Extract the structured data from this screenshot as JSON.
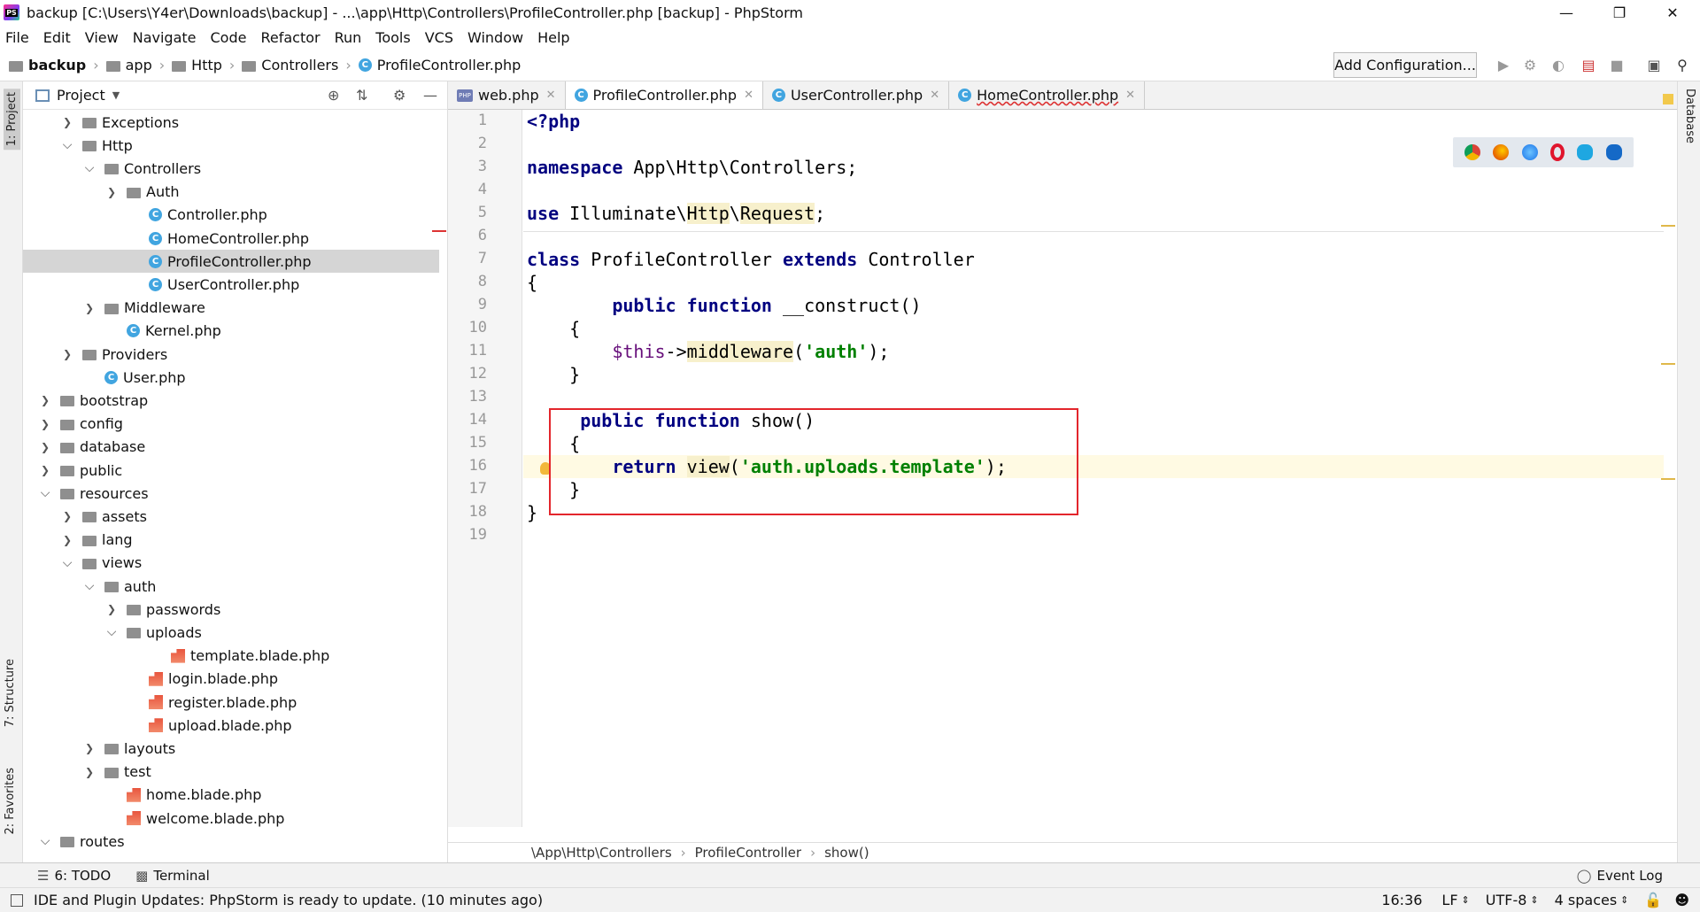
{
  "window": {
    "title": "backup [C:\\Users\\Y4er\\Downloads\\backup] - ...\\app\\Http\\Controllers\\ProfileController.php [backup] - PhpStorm"
  },
  "menu": [
    "File",
    "Edit",
    "View",
    "Navigate",
    "Code",
    "Refactor",
    "Run",
    "Tools",
    "VCS",
    "Window",
    "Help"
  ],
  "breadcrumb": [
    "backup",
    "app",
    "Http",
    "Controllers",
    "ProfileController.php"
  ],
  "toolbar": {
    "add_configuration": "Add Configuration..."
  },
  "side_tabs": {
    "project": "1: Project",
    "structure": "7: Structure",
    "favorites": "2: Favorites",
    "database": "Database"
  },
  "project_panel": {
    "title": "Project",
    "tree": [
      {
        "label": "Exceptions",
        "type": "folder",
        "level": 2,
        "arrow": "right"
      },
      {
        "label": "Http",
        "type": "folder",
        "level": 2,
        "arrow": "down"
      },
      {
        "label": "Controllers",
        "type": "folder",
        "level": 3,
        "arrow": "down"
      },
      {
        "label": "Auth",
        "type": "folder",
        "level": 4,
        "arrow": "right"
      },
      {
        "label": "Controller.php",
        "type": "class",
        "level": 5,
        "arrow": ""
      },
      {
        "label": "HomeController.php",
        "type": "class",
        "level": 5,
        "arrow": ""
      },
      {
        "label": "ProfileController.php",
        "type": "class",
        "level": 5,
        "arrow": "",
        "selected": true
      },
      {
        "label": "UserController.php",
        "type": "class",
        "level": 5,
        "arrow": ""
      },
      {
        "label": "Middleware",
        "type": "folder",
        "level": 3,
        "arrow": "right"
      },
      {
        "label": "Kernel.php",
        "type": "class",
        "level": 4,
        "arrow": ""
      },
      {
        "label": "Providers",
        "type": "folder",
        "level": 2,
        "arrow": "right"
      },
      {
        "label": "User.php",
        "type": "class",
        "level": 3,
        "arrow": ""
      },
      {
        "label": "bootstrap",
        "type": "folder",
        "level": 1,
        "arrow": "right"
      },
      {
        "label": "config",
        "type": "folder",
        "level": 1,
        "arrow": "right"
      },
      {
        "label": "database",
        "type": "folder",
        "level": 1,
        "arrow": "right"
      },
      {
        "label": "public",
        "type": "folder",
        "level": 1,
        "arrow": "right"
      },
      {
        "label": "resources",
        "type": "folder",
        "level": 1,
        "arrow": "down"
      },
      {
        "label": "assets",
        "type": "folder",
        "level": 2,
        "arrow": "right"
      },
      {
        "label": "lang",
        "type": "folder",
        "level": 2,
        "arrow": "right"
      },
      {
        "label": "views",
        "type": "folder",
        "level": 2,
        "arrow": "down"
      },
      {
        "label": "auth",
        "type": "folder",
        "level": 3,
        "arrow": "down"
      },
      {
        "label": "passwords",
        "type": "folder",
        "level": 4,
        "arrow": "right"
      },
      {
        "label": "uploads",
        "type": "folder",
        "level": 4,
        "arrow": "down"
      },
      {
        "label": "template.blade.php",
        "type": "blade",
        "level": 6,
        "arrow": ""
      },
      {
        "label": "login.blade.php",
        "type": "blade",
        "level": 5,
        "arrow": ""
      },
      {
        "label": "register.blade.php",
        "type": "blade",
        "level": 5,
        "arrow": ""
      },
      {
        "label": "upload.blade.php",
        "type": "blade",
        "level": 5,
        "arrow": ""
      },
      {
        "label": "layouts",
        "type": "folder",
        "level": 3,
        "arrow": "right"
      },
      {
        "label": "test",
        "type": "folder",
        "level": 3,
        "arrow": "right"
      },
      {
        "label": "home.blade.php",
        "type": "blade",
        "level": 4,
        "arrow": ""
      },
      {
        "label": "welcome.blade.php",
        "type": "blade",
        "level": 4,
        "arrow": ""
      },
      {
        "label": "routes",
        "type": "folder",
        "level": 1,
        "arrow": "down"
      }
    ]
  },
  "editor_tabs": [
    {
      "label": "web.php",
      "icon": "php"
    },
    {
      "label": "ProfileController.php",
      "icon": "class",
      "active": true
    },
    {
      "label": "UserController.php",
      "icon": "class"
    },
    {
      "label": "HomeController.php",
      "icon": "class"
    }
  ],
  "line_numbers": [
    "1",
    "2",
    "3",
    "4",
    "5",
    "6",
    "7",
    "8",
    "9",
    "10",
    "11",
    "12",
    "13",
    "14",
    "15",
    "16",
    "17",
    "18",
    "19"
  ],
  "code": {
    "l1": "<?php",
    "l3_kw": "namespace",
    "l3_rest": " App\\Http\\Controllers;",
    "l5_kw": "use",
    "l5_a": " Illuminate\\",
    "l5_b": "Http",
    "l5_c": "\\",
    "l5_d": "Request",
    "l5_e": ";",
    "l7_kw1": "class",
    "l7_a": " ProfileController ",
    "l7_kw2": "extends",
    "l7_b": " Controller",
    "l8": "{",
    "l9_kw": "        public function",
    "l9_rest": " __construct()",
    "l10": "    {",
    "l11_var": "        $this",
    "l11_a": "->",
    "l11_m": "middleware",
    "l11_b": "(",
    "l11_s": "'auth'",
    "l11_c": ");",
    "l12": "    }",
    "l14_kw": "     public function",
    "l14_rest": " show()",
    "l15": "    {",
    "l16_kw": "        return",
    "l16_a": " ",
    "l16_m": "view",
    "l16_b": "(",
    "l16_s": "'auth.uploads.template'",
    "l16_c": ");",
    "l17": "    }",
    "l18": "}"
  },
  "editor_breadcrumb": [
    "\\App\\Http\\Controllers",
    "ProfileController",
    "show()"
  ],
  "bottom_tools": {
    "todo": "6: TODO",
    "terminal": "Terminal",
    "event_log": "Event Log"
  },
  "status": {
    "message": "IDE and Plugin Updates: PhpStorm is ready to update. (10 minutes ago)",
    "position": "16:36",
    "line_sep": "LF",
    "encoding": "UTF-8",
    "indent": "4 spaces"
  }
}
